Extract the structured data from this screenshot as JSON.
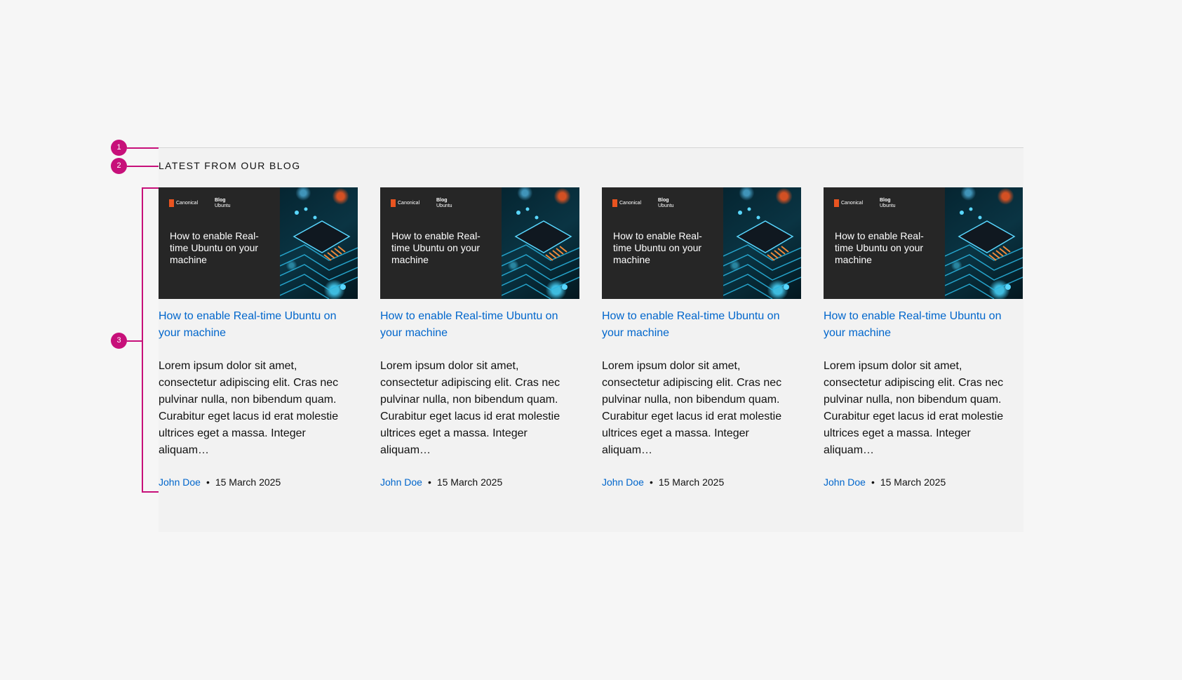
{
  "section": {
    "title": "LATEST FROM OUR BLOG"
  },
  "annotations": [
    "1",
    "2",
    "3"
  ],
  "cards": [
    {
      "image": {
        "brand": "Canonical",
        "tag_top": "Blog",
        "tag_bottom": "Ubuntu",
        "title": "How to enable Real-time Ubuntu on your machine"
      },
      "title": "How to enable Real-time Ubuntu on your machine",
      "excerpt": "Lorem ipsum dolor sit amet, consectetur adipiscing elit. Cras nec pulvinar nulla, non bibendum quam. Curabitur eget lacus id erat molestie ultrices eget a massa. Integer aliquam…",
      "author": "John Doe",
      "separator": "•",
      "date": "15 March 2025"
    },
    {
      "image": {
        "brand": "Canonical",
        "tag_top": "Blog",
        "tag_bottom": "Ubuntu",
        "title": "How to enable Real-time Ubuntu on your machine"
      },
      "title": "How to enable Real-time Ubuntu on your machine",
      "excerpt": "Lorem ipsum dolor sit amet, consectetur adipiscing elit. Cras nec pulvinar nulla, non bibendum quam. Curabitur eget lacus id erat molestie ultrices eget a massa. Integer aliquam…",
      "author": "John Doe",
      "separator": "•",
      "date": "15 March 2025"
    },
    {
      "image": {
        "brand": "Canonical",
        "tag_top": "Blog",
        "tag_bottom": "Ubuntu",
        "title": "How to enable Real-time Ubuntu on your machine"
      },
      "title": "How to enable Real-time Ubuntu on your machine",
      "excerpt": "Lorem ipsum dolor sit amet, consectetur adipiscing elit. Cras nec pulvinar nulla, non bibendum quam. Curabitur eget lacus id erat molestie ultrices eget a massa. Integer aliquam…",
      "author": "John Doe",
      "separator": "•",
      "date": "15 March 2025"
    },
    {
      "image": {
        "brand": "Canonical",
        "tag_top": "Blog",
        "tag_bottom": "Ubuntu",
        "title": "How to enable Real-time Ubuntu on your machine"
      },
      "title": "How to enable Real-time Ubuntu on your machine",
      "excerpt": "Lorem ipsum dolor sit amet, consectetur adipiscing elit. Cras nec pulvinar nulla, non bibendum quam. Curabitur eget lacus id erat molestie ultrices eget a massa. Integer aliquam…",
      "author": "John Doe",
      "separator": "•",
      "date": "15 March 2025"
    }
  ],
  "icons": {
    "brand_logo": "canonical-logo-icon",
    "thumbnail_art": "circuit-board-image"
  },
  "colors": {
    "page_background": "#f6f6f6",
    "panel_background": "#f2f2f2",
    "link": "#0066cc",
    "annotation": "#c7107a",
    "thumbnail_background": "#262626",
    "brand_orange": "#e95420"
  }
}
